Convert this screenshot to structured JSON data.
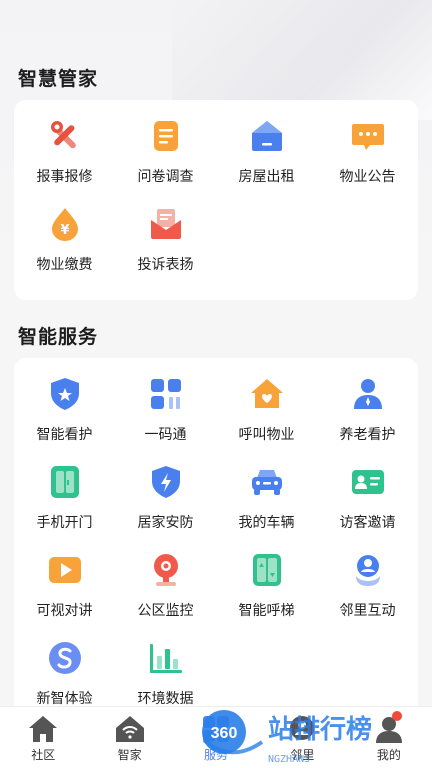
{
  "sections": {
    "housekeeper": {
      "title": "智慧管家",
      "items": [
        {
          "label": "报事报修",
          "icon": "wrench-screwdriver-icon"
        },
        {
          "label": "问卷调查",
          "icon": "document-list-icon"
        },
        {
          "label": "房屋出租",
          "icon": "house-icon"
        },
        {
          "label": "物业公告",
          "icon": "message-bubble-icon"
        },
        {
          "label": "物业缴费",
          "icon": "yen-drop-icon"
        },
        {
          "label": "投诉表扬",
          "icon": "envelope-icon"
        }
      ]
    },
    "services": {
      "title": "智能服务",
      "items": [
        {
          "label": "智能看护",
          "icon": "shield-star-icon"
        },
        {
          "label": "一码通",
          "icon": "qr-grid-icon"
        },
        {
          "label": "呼叫物业",
          "icon": "home-heart-icon"
        },
        {
          "label": "养老看护",
          "icon": "person-icon"
        },
        {
          "label": "手机开门",
          "icon": "door-icon"
        },
        {
          "label": "居家安防",
          "icon": "shield-bolt-icon"
        },
        {
          "label": "我的车辆",
          "icon": "car-icon"
        },
        {
          "label": "访客邀请",
          "icon": "id-card-icon"
        },
        {
          "label": "可视对讲",
          "icon": "video-play-icon"
        },
        {
          "label": "公区监控",
          "icon": "camera-icon"
        },
        {
          "label": "智能呼梯",
          "icon": "elevator-icon"
        },
        {
          "label": "邻里互动",
          "icon": "people-icon"
        },
        {
          "label": "新智体验",
          "icon": "s-circle-icon"
        },
        {
          "label": "环境数据",
          "icon": "bar-chart-icon"
        }
      ]
    }
  },
  "tabbar": {
    "tabs": [
      {
        "label": "社区",
        "icon": "home-icon"
      },
      {
        "label": "智家",
        "icon": "wifi-home-icon"
      },
      {
        "label": "服务",
        "icon": "grid-icon"
      },
      {
        "label": "邻里",
        "icon": "neighbor-icon"
      },
      {
        "label": "我的",
        "icon": "user-icon"
      }
    ]
  },
  "watermark": {
    "text": "站排行榜",
    "sub": "NGZHAN3",
    "logo": "360"
  },
  "colors": {
    "orange": "#f7a33a",
    "red": "#ef5a4a",
    "blue": "#4a80ee",
    "green": "#2fc28e",
    "purple": "#6b6ef2"
  }
}
